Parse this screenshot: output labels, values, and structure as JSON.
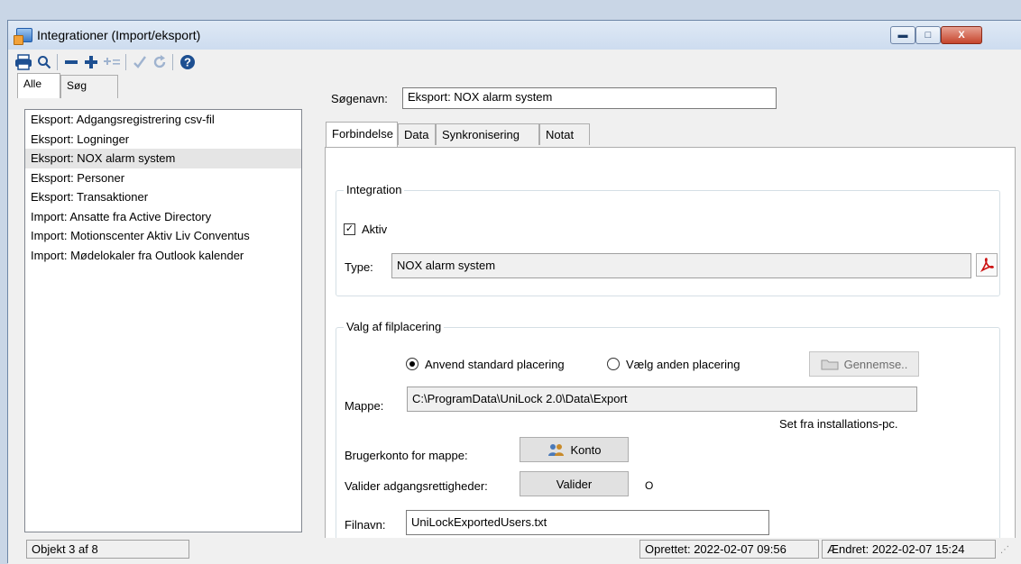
{
  "window": {
    "title": "Integrationer  (Import/eksport)",
    "buttons": {
      "minimize": "▬",
      "maximize": "□",
      "close": "X"
    }
  },
  "toolbar": {
    "icons": [
      "print-icon",
      "search-icon",
      "remove-icon",
      "add-icon",
      "add-multiple-icon",
      "check-icon",
      "refresh-icon",
      "help-icon"
    ]
  },
  "left": {
    "tabs": [
      "Alle",
      "Søg"
    ],
    "items": [
      "Eksport: Adgangsregistrering csv-fil",
      "Eksport: Logninger",
      "Eksport: NOX alarm system",
      "Eksport: Personer",
      "Eksport: Transaktioner",
      "Import: Ansatte fra Active Directory",
      "Import: Motionscenter Aktiv Liv Conventus",
      "Import: Mødelokaler fra Outlook kalender"
    ],
    "selected_index": 2
  },
  "detail": {
    "search_name_label": "Søgenavn:",
    "search_name_value": "Eksport: NOX alarm system",
    "tabs": [
      "Forbindelse",
      "Data",
      "Synkronisering",
      "Notat"
    ],
    "integration": {
      "title": "Integration",
      "active_label": "Aktiv",
      "active_checked": true,
      "type_label": "Type:",
      "type_value": "NOX alarm system"
    },
    "file": {
      "title": "Valg af filplacering",
      "radio_standard": "Anvend standard placering",
      "radio_other": "Vælg anden placering",
      "browse_label": "Gennemse..",
      "folder_label": "Mappe:",
      "folder_value": "C:\\ProgramData\\UniLock 2.0\\Data\\Export",
      "note": "Set fra installations-pc.",
      "account_label": "Brugerkonto for mappe:",
      "account_button": "Konto",
      "validate_label": "Valider adgangsrettigheder:",
      "validate_button": "Valider",
      "status_glyph": "O",
      "filename_label": "Filnavn:",
      "filename_value": "UniLockExportedUsers.txt"
    }
  },
  "status": {
    "object": "Objekt 3 af 8",
    "created": "Oprettet: 2022-02-07  09:56",
    "changed": "Ændret: 2022-02-07  15:24"
  },
  "colors": {
    "accent": "#1a3a66",
    "pdf": "#cc1111",
    "toolbar_icons": "#1d4f91"
  }
}
